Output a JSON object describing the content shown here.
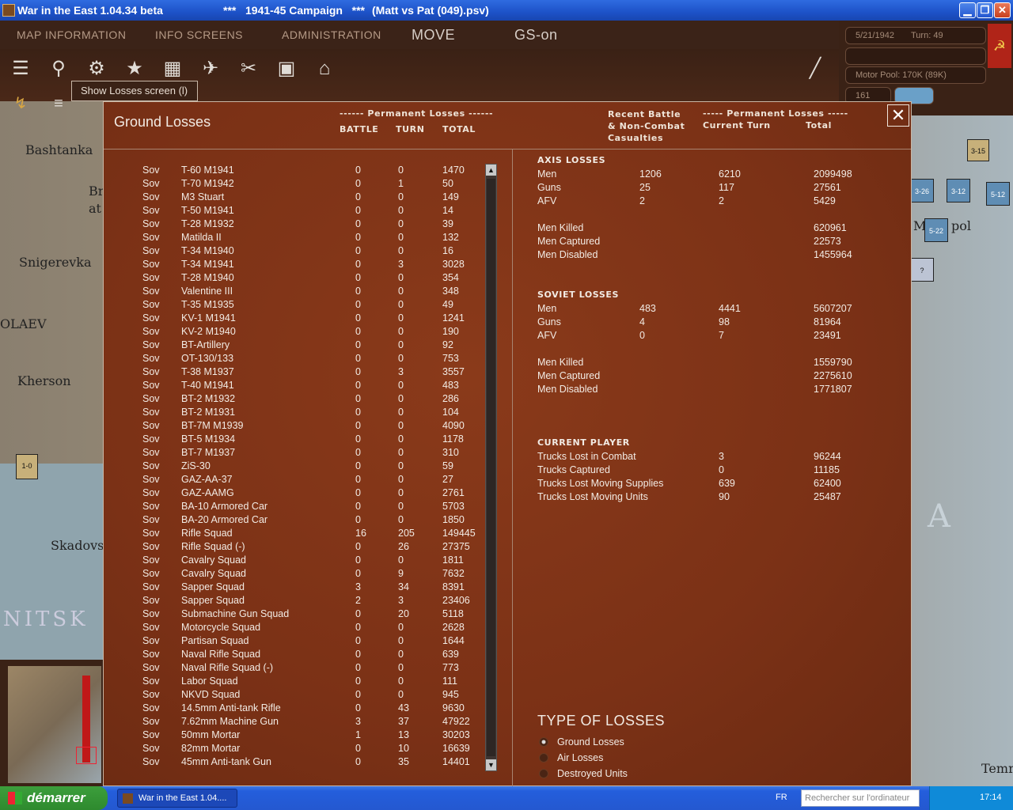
{
  "window": {
    "title": "War in the East 1.04.34 beta",
    "campaign": "***   1941-45 Campaign   ***",
    "file": "(Matt vs Pat (049).psv)",
    "minimize": "▁",
    "restore": "❐",
    "close": "✕"
  },
  "menu": {
    "map_information": "MAP INFORMATION",
    "info_screens": "INFO SCREENS",
    "administration": "ADMINISTRATION",
    "move": "MOVE",
    "gs": "GS-on"
  },
  "status": {
    "date": "5/21/1942",
    "turn": "Turn: 49",
    "motor_pool": "Motor Pool:  170K (89K)",
    "value": "161"
  },
  "tooltip": "Show Losses screen (l)",
  "map_labels": {
    "bashtanka": "Bashtanka",
    "br": "Br",
    "at": "at",
    "snigerevka": "Snigerevka",
    "olaev": "OLAEV",
    "kherson": "Kherson",
    "skadovs": "Skadovs",
    "nitsk": "NITSK",
    "pol": "pol",
    "temr": "Temr",
    "a": "A",
    "m": "M"
  },
  "map_units": [
    {
      "label": "3-15"
    },
    {
      "label": "3-26"
    },
    {
      "label": "3-12"
    },
    {
      "label": "5-12"
    },
    {
      "label": "5-22"
    },
    {
      "label": "?"
    }
  ],
  "minimap_unit": "1-0",
  "dialog": {
    "title": "Ground Losses",
    "perm_losses_header": "------ Permanent Losses ------",
    "col_battle": "BATTLE",
    "col_turn": "TURN",
    "col_total": "TOTAL",
    "recent_header": "Recent Battle\n& Non-Combat\nCasualties",
    "perm_losses_header2": "----- Permanent Losses -----",
    "current_turn": "Current Turn",
    "total": "Total",
    "close": "✕"
  },
  "losses": [
    {
      "nat": "Sov",
      "type": "T-60 M1941",
      "battle": "0",
      "turn": "0",
      "total": "1470"
    },
    {
      "nat": "Sov",
      "type": "T-70 M1942",
      "battle": "0",
      "turn": "1",
      "total": "50"
    },
    {
      "nat": "Sov",
      "type": "M3 Stuart",
      "battle": "0",
      "turn": "0",
      "total": "149"
    },
    {
      "nat": "Sov",
      "type": "T-50 M1941",
      "battle": "0",
      "turn": "0",
      "total": "14"
    },
    {
      "nat": "Sov",
      "type": "T-28 M1932",
      "battle": "0",
      "turn": "0",
      "total": "39"
    },
    {
      "nat": "Sov",
      "type": "Matilda II",
      "battle": "0",
      "turn": "0",
      "total": "132"
    },
    {
      "nat": "Sov",
      "type": "T-34 M1940",
      "battle": "0",
      "turn": "0",
      "total": "16"
    },
    {
      "nat": "Sov",
      "type": "T-34 M1941",
      "battle": "0",
      "turn": "3",
      "total": "3028"
    },
    {
      "nat": "Sov",
      "type": "T-28 M1940",
      "battle": "0",
      "turn": "0",
      "total": "354"
    },
    {
      "nat": "Sov",
      "type": "Valentine III",
      "battle": "0",
      "turn": "0",
      "total": "348"
    },
    {
      "nat": "Sov",
      "type": "T-35 M1935",
      "battle": "0",
      "turn": "0",
      "total": "49"
    },
    {
      "nat": "Sov",
      "type": "KV-1 M1941",
      "battle": "0",
      "turn": "0",
      "total": "1241"
    },
    {
      "nat": "Sov",
      "type": "KV-2 M1940",
      "battle": "0",
      "turn": "0",
      "total": "190"
    },
    {
      "nat": "Sov",
      "type": "BT-Artillery",
      "battle": "0",
      "turn": "0",
      "total": "92"
    },
    {
      "nat": "Sov",
      "type": "OT-130/133",
      "battle": "0",
      "turn": "0",
      "total": "753"
    },
    {
      "nat": "Sov",
      "type": "T-38 M1937",
      "battle": "0",
      "turn": "3",
      "total": "3557"
    },
    {
      "nat": "Sov",
      "type": "T-40 M1941",
      "battle": "0",
      "turn": "0",
      "total": "483"
    },
    {
      "nat": "Sov",
      "type": "BT-2 M1932",
      "battle": "0",
      "turn": "0",
      "total": "286"
    },
    {
      "nat": "Sov",
      "type": "BT-2 M1931",
      "battle": "0",
      "turn": "0",
      "total": "104"
    },
    {
      "nat": "Sov",
      "type": "BT-7M M1939",
      "battle": "0",
      "turn": "0",
      "total": "4090"
    },
    {
      "nat": "Sov",
      "type": "BT-5 M1934",
      "battle": "0",
      "turn": "0",
      "total": "1178"
    },
    {
      "nat": "Sov",
      "type": "BT-7 M1937",
      "battle": "0",
      "turn": "0",
      "total": "310"
    },
    {
      "nat": "Sov",
      "type": "ZiS-30",
      "battle": "0",
      "turn": "0",
      "total": "59"
    },
    {
      "nat": "Sov",
      "type": "GAZ-AA-37",
      "battle": "0",
      "turn": "0",
      "total": "27"
    },
    {
      "nat": "Sov",
      "type": "GAZ-AAMG",
      "battle": "0",
      "turn": "0",
      "total": "2761"
    },
    {
      "nat": "Sov",
      "type": "BA-10 Armored Car",
      "battle": "0",
      "turn": "0",
      "total": "5703"
    },
    {
      "nat": "Sov",
      "type": "BA-20 Armored Car",
      "battle": "0",
      "turn": "0",
      "total": "1850"
    },
    {
      "nat": "Sov",
      "type": "Rifle Squad",
      "battle": "16",
      "turn": "205",
      "total": "149445"
    },
    {
      "nat": "Sov",
      "type": "Rifle Squad (-)",
      "battle": "0",
      "turn": "26",
      "total": "27375"
    },
    {
      "nat": "Sov",
      "type": "Cavalry Squad",
      "battle": "0",
      "turn": "0",
      "total": "1811"
    },
    {
      "nat": "Sov",
      "type": "Cavalry Squad",
      "battle": "0",
      "turn": "9",
      "total": "7632"
    },
    {
      "nat": "Sov",
      "type": "Sapper Squad",
      "battle": "3",
      "turn": "34",
      "total": "8391"
    },
    {
      "nat": "Sov",
      "type": "Sapper Squad",
      "battle": "2",
      "turn": "3",
      "total": "23406"
    },
    {
      "nat": "Sov",
      "type": "Submachine Gun Squad",
      "battle": "0",
      "turn": "20",
      "total": "5118"
    },
    {
      "nat": "Sov",
      "type": "Motorcycle Squad",
      "battle": "0",
      "turn": "0",
      "total": "2628"
    },
    {
      "nat": "Sov",
      "type": "Partisan Squad",
      "battle": "0",
      "turn": "0",
      "total": "1644"
    },
    {
      "nat": "Sov",
      "type": "Naval Rifle Squad",
      "battle": "0",
      "turn": "0",
      "total": "639"
    },
    {
      "nat": "Sov",
      "type": "Naval Rifle Squad (-)",
      "battle": "0",
      "turn": "0",
      "total": "773"
    },
    {
      "nat": "Sov",
      "type": "Labor Squad",
      "battle": "0",
      "turn": "0",
      "total": "111"
    },
    {
      "nat": "Sov",
      "type": "NKVD Squad",
      "battle": "0",
      "turn": "0",
      "total": "945"
    },
    {
      "nat": "Sov",
      "type": "14.5mm Anti-tank Rifle",
      "battle": "0",
      "turn": "43",
      "total": "9630"
    },
    {
      "nat": "Sov",
      "type": "7.62mm Machine Gun",
      "battle": "3",
      "turn": "37",
      "total": "47922"
    },
    {
      "nat": "Sov",
      "type": "50mm Mortar",
      "battle": "1",
      "turn": "13",
      "total": "30203"
    },
    {
      "nat": "Sov",
      "type": "82mm Mortar",
      "battle": "0",
      "turn": "10",
      "total": "16639"
    },
    {
      "nat": "Sov",
      "type": "45mm Anti-tank Gun",
      "battle": "0",
      "turn": "35",
      "total": "14401"
    }
  ],
  "axis": {
    "header": "AXIS LOSSES",
    "rows": [
      {
        "label": "Men",
        "recent": "1206",
        "turn": "6210",
        "total": "2099498"
      },
      {
        "label": "Guns",
        "recent": "25",
        "turn": "117",
        "total": "27561"
      },
      {
        "label": "AFV",
        "recent": "2",
        "turn": "2",
        "total": "5429"
      }
    ],
    "killed_label": "Men Killed",
    "killed": "620961",
    "captured_label": "Men Captured",
    "captured": "22573",
    "disabled_label": "Men Disabled",
    "disabled": "1455964"
  },
  "soviet": {
    "header": "SOVIET LOSSES",
    "rows": [
      {
        "label": "Men",
        "recent": "483",
        "turn": "4441",
        "total": "5607207"
      },
      {
        "label": "Guns",
        "recent": "4",
        "turn": "98",
        "total": "81964"
      },
      {
        "label": "AFV",
        "recent": "0",
        "turn": "7",
        "total": "23491"
      }
    ],
    "killed_label": "Men Killed",
    "killed": "1559790",
    "captured_label": "Men Captured",
    "captured": "2275610",
    "disabled_label": "Men Disabled",
    "disabled": "1771807"
  },
  "current_player": {
    "header": "CURRENT PLAYER",
    "rows": [
      {
        "label": "Trucks Lost in Combat",
        "turn": "3",
        "total": "96244"
      },
      {
        "label": "Trucks Captured",
        "turn": "0",
        "total": "11185"
      },
      {
        "label": "Trucks Lost Moving Supplies",
        "turn": "639",
        "total": "62400"
      },
      {
        "label": "Trucks Lost Moving Units",
        "turn": "90",
        "total": "25487"
      }
    ]
  },
  "type_of_losses": {
    "header": "TYPE OF LOSSES",
    "options": [
      "Ground Losses",
      "Air Losses",
      "Destroyed Units"
    ],
    "selected": "Ground Losses"
  },
  "taskbar": {
    "start": "démarrer",
    "task": "War in the East 1.04....",
    "lang": "FR",
    "search_placeholder": "Rechercher sur l'ordinateur",
    "clock": "17:14"
  },
  "colors": {
    "dialog_bg": "#7b3116",
    "topbar_bg": "#3b2318",
    "soviet_red": "#b02418",
    "xp_blue": "#245edc",
    "start_green": "#2e8a2e"
  }
}
